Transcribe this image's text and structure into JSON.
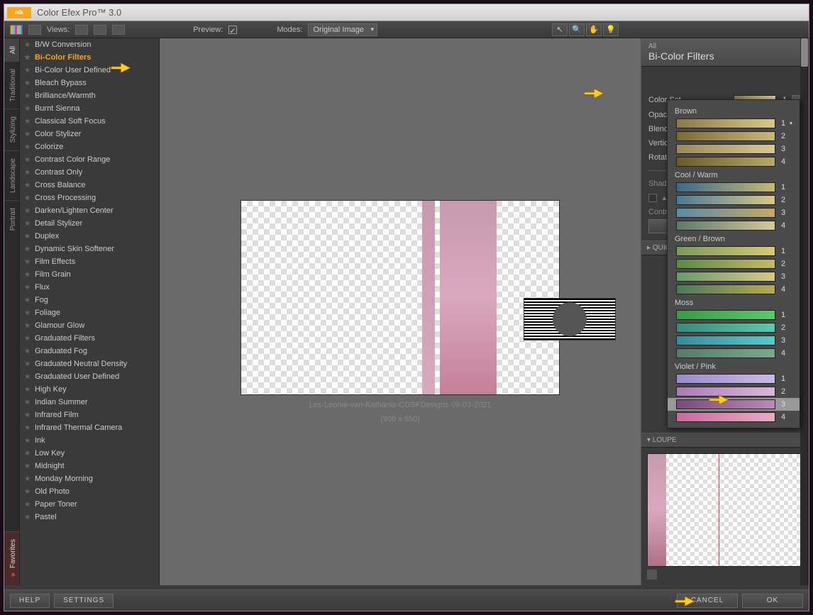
{
  "app": {
    "brand": "nik",
    "title": "Color Efex Pro™ 3.0"
  },
  "toolbar": {
    "views_label": "Views:",
    "preview_label": "Preview:",
    "modes_label": "Modes:",
    "modes_value": "Original Image"
  },
  "side_tabs": [
    "All",
    "Traditional",
    "Stylizing",
    "Landscape",
    "Portrait"
  ],
  "side_favorites": "Favorites",
  "filters": [
    "B/W Conversion",
    "Bi-Color Filters",
    "Bi-Color User Defined",
    "Bleach Bypass",
    "Brilliance/Warmth",
    "Burnt Sienna",
    "Classical Soft Focus",
    "Color Stylizer",
    "Colorize",
    "Contrast Color Range",
    "Contrast Only",
    "Cross Balance",
    "Cross Processing",
    "Darken/Lighten Center",
    "Detail Stylizer",
    "Duplex",
    "Dynamic Skin Softener",
    "Film Effects",
    "Film Grain",
    "Flux",
    "Fog",
    "Foliage",
    "Glamour Glow",
    "Graduated Filters",
    "Graduated Fog",
    "Graduated Neutral Density",
    "Graduated User Defined",
    "High Key",
    "Indian Summer",
    "Infrared Film",
    "Infrared Thermal Camera",
    "Ink",
    "Low Key",
    "Midnight",
    "Monday Morning",
    "Old Photo",
    "Paper Toner",
    "Pastel"
  ],
  "highlighted_filter_index": 1,
  "canvas": {
    "caption1": "Les-Leonie-van-Kathania-CGSFDesigns-09-03-2021",
    "caption2": "(900 x 550)"
  },
  "right_panel": {
    "all": "All",
    "title": "Bi-Color Filters",
    "color_set": "Color Set",
    "color_set_val": "1",
    "opacity": "Opacity",
    "blend": "Blend",
    "vertical_shift": "Vertical Shift",
    "rotation": "Rotation",
    "shadows_highlights": "Shadows / Highli",
    "control_points": "Control Points",
    "quick_save": "QUICK SAVE",
    "loupe": "LOUPE"
  },
  "color_groups": [
    {
      "name": "Brown",
      "swatches": [
        [
          "#8a7a4a",
          "#d8c888"
        ],
        [
          "#7a6a3a",
          "#c8b878"
        ],
        [
          "#9a8a5a",
          "#d8c898"
        ],
        [
          "#6a5a2a",
          "#b8a868"
        ]
      ]
    },
    {
      "name": "Cool / Warm",
      "swatches": [
        [
          "#3a6a8a",
          "#c8b878"
        ],
        [
          "#4a7a9a",
          "#d8c888"
        ],
        [
          "#5a8aaa",
          "#c8a868"
        ],
        [
          "#5a7a6a",
          "#d8c898"
        ]
      ]
    },
    {
      "name": "Green / Brown",
      "swatches": [
        [
          "#7a9a5a",
          "#d8c878"
        ],
        [
          "#5a8a4a",
          "#c8b868"
        ],
        [
          "#6a9a6a",
          "#d8c888"
        ],
        [
          "#4a7a5a",
          "#b8a858"
        ]
      ]
    },
    {
      "name": "Moss",
      "swatches": [
        [
          "#3a9a4a",
          "#5aca6a"
        ],
        [
          "#3a8a7a",
          "#5acaaa"
        ],
        [
          "#3a8a9a",
          "#5acaca"
        ],
        [
          "#5a7a6a",
          "#7aaa8a"
        ]
      ]
    },
    {
      "name": "Violet / Pink",
      "swatches": [
        [
          "#9a8aca",
          "#cabae8"
        ],
        [
          "#aa7aba",
          "#dab8d8"
        ],
        [
          "#7a4a7a",
          "#ba8aba"
        ],
        [
          "#ca6a9a",
          "#eaaac8"
        ]
      ]
    }
  ],
  "selected_color": {
    "group": 4,
    "index": 2
  },
  "bottom": {
    "help": "HELP",
    "settings": "SETTINGS",
    "cancel": "CANCEL",
    "ok": "OK"
  }
}
